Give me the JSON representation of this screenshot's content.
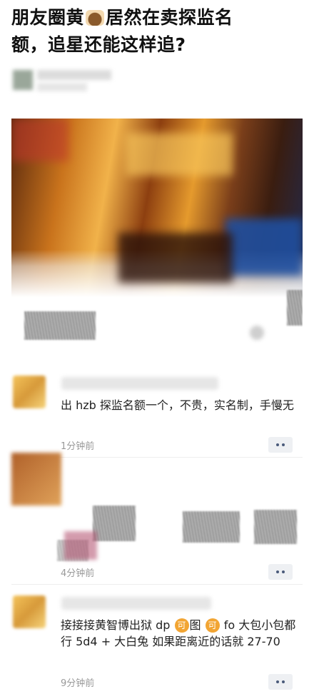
{
  "headline": {
    "line1_a": "朋友圈黄",
    "emoji": "ox-emoji",
    "line1_b": "居然在卖探监名",
    "line2": "额，追星还能这样追?"
  },
  "post": {
    "photo_palette": [
      "#c9731c",
      "#f1b24a",
      "#5b2a0e",
      "#1d2d5a",
      "#ffffff"
    ]
  },
  "comments": [
    {
      "text": "出 hzb 探监名额一个，不贵，实名制，手慢无",
      "time": "1分钟前",
      "more_label": "••"
    },
    {
      "time": "4分钟前",
      "more_label": "••"
    },
    {
      "text_a": "接接接黄智博出狱 dp",
      "badge1": "可",
      "text_b": "图",
      "badge2": "可",
      "text_c": "fo 大包小包都行 5d4 + 大白兔 如果距离近的话就 27-70",
      "time": "9分钟前",
      "more_label": "••"
    }
  ],
  "colors": {
    "time_gray": "#999999",
    "badge_orange": "#f2a533",
    "more_bg": "#eef0f3"
  }
}
